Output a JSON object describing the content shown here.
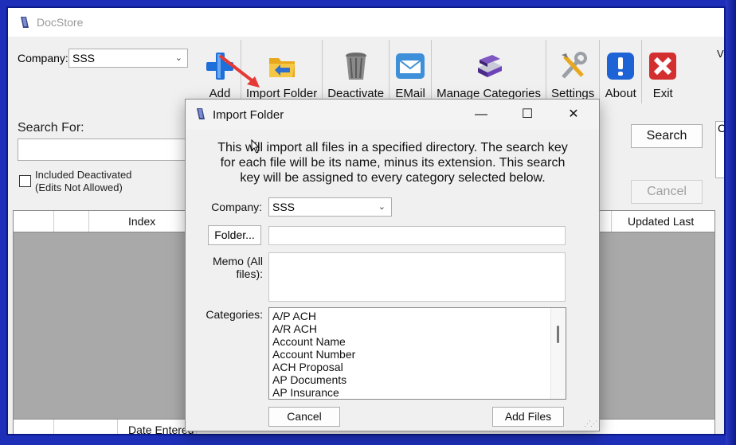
{
  "app": {
    "title": "DocStore"
  },
  "company": {
    "label": "Company:",
    "value": "SSS"
  },
  "toolbar": {
    "add": "Add",
    "import_folder": "Import Folder",
    "deactivate": "Deactivate",
    "email": "EMail",
    "manage_categories": "Manage Categories",
    "settings": "Settings",
    "about": "About",
    "exit": "Exit"
  },
  "search": {
    "label": "Search For:",
    "value": "",
    "search_button": "Search",
    "cancel_button": "Cancel"
  },
  "included_deactivated": {
    "line1": "Included Deactivated",
    "line2": "(Edits Not Allowed)",
    "checked": false
  },
  "right_partial": {
    "top": "V",
    "stub": "C"
  },
  "grid": {
    "columns_top": [
      "",
      "",
      "Index",
      "Updated Last"
    ],
    "columns_bottom": [
      "",
      "",
      "Date Entered"
    ]
  },
  "dialog": {
    "title": "Import Folder",
    "description_lines": [
      "This will import all files in a specified directory.  The search key",
      "for each file will be its name, minus its extension.  This search",
      "key will be assigned to every category selected below."
    ],
    "company_label": "Company:",
    "company_value": "SSS",
    "folder_button": "Folder...",
    "folder_value": "",
    "memo_label": "Memo (All files):",
    "memo_value": "",
    "categories_label": "Categories:",
    "categories": [
      "A/P ACH",
      "A/R ACH",
      "Account Name",
      "Account Number",
      "ACH Proposal",
      "AP Documents",
      "AP Insurance"
    ],
    "cancel_button": "Cancel",
    "add_files_button": "Add Files",
    "window_controls": {
      "minimize": "—",
      "maximize": "☐",
      "close": "✕"
    }
  },
  "colors": {
    "frame": "#1d2fb8",
    "grid_body": "#a9a9a9",
    "arrow": "#e53935",
    "exit_icon": "#d32f2f",
    "about_icon": "#1e63d6",
    "add_icon": "#1e6fd9"
  },
  "icons": {
    "app": "docstore-logo-icon",
    "add": "blue-plus-icon",
    "import_folder": "folder-arrow-icon",
    "deactivate": "trash-can-icon",
    "email": "envelope-icon",
    "manage_categories": "books-icon",
    "settings": "tools-icon",
    "about": "info-icon",
    "exit": "red-x-icon"
  }
}
